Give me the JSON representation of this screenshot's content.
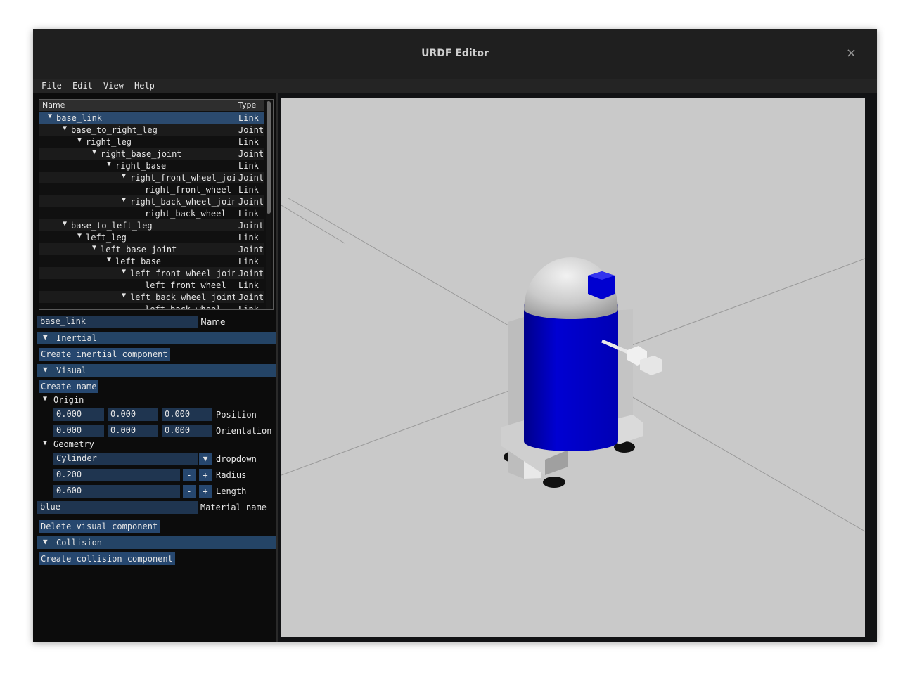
{
  "window": {
    "title": "URDF Editor",
    "close_glyph": "×"
  },
  "menu": [
    "File",
    "Edit",
    "View",
    "Help"
  ],
  "tree": {
    "columns": {
      "name": "Name",
      "type": "Type"
    },
    "rows": [
      {
        "name": "base_link",
        "type": "Link"
      },
      {
        "name": "base_to_right_leg",
        "type": "Joint"
      },
      {
        "name": "right_leg",
        "type": "Link"
      },
      {
        "name": "right_base_joint",
        "type": "Joint"
      },
      {
        "name": "right_base",
        "type": "Link"
      },
      {
        "name": "right_front_wheel_joi",
        "type": "Joint"
      },
      {
        "name": "right_front_wheel",
        "type": "Link"
      },
      {
        "name": "right_back_wheel_join",
        "type": "Joint"
      },
      {
        "name": "right_back_wheel",
        "type": "Link"
      },
      {
        "name": "base_to_left_leg",
        "type": "Joint"
      },
      {
        "name": "left_leg",
        "type": "Link"
      },
      {
        "name": "left_base_joint",
        "type": "Joint"
      },
      {
        "name": "left_base",
        "type": "Link"
      },
      {
        "name": "left_front_wheel_join",
        "type": "Joint"
      },
      {
        "name": "left_front_wheel",
        "type": "Link"
      },
      {
        "name": "left_back_wheel_joint",
        "type": "Joint"
      },
      {
        "name": "left_back_wheel",
        "type": "Link"
      }
    ]
  },
  "properties": {
    "name_value": "base_link",
    "name_label": "Name",
    "inertial": {
      "header": "Inertial",
      "create_button": "Create inertial component"
    },
    "visual": {
      "header": "Visual",
      "create_name_button": "Create name",
      "origin": {
        "header": "Origin",
        "position": [
          "0.000",
          "0.000",
          "0.000"
        ],
        "position_label": "Position",
        "orientation": [
          "0.000",
          "0.000",
          "0.000"
        ],
        "orientation_label": "Orientation"
      },
      "geometry": {
        "header": "Geometry",
        "type_value": "Cylinder",
        "type_label": "dropdown",
        "radius_value": "0.200",
        "radius_label": "Radius",
        "length_value": "0.600",
        "length_label": "Length",
        "minus": "-",
        "plus": "+"
      },
      "material_value": "blue",
      "material_label": "Material name",
      "delete_button": "Delete visual component"
    },
    "collision": {
      "header": "Collision",
      "create_button": "Create collision component"
    }
  },
  "icons": {
    "expand_arrow": "▼",
    "dropdown_arrow": "▼"
  },
  "colors": {
    "accent": "#26476f",
    "selected_row": "#2b4a6e",
    "robot_body": "#0000c8",
    "viewport_bg": "#c9c9c9"
  }
}
